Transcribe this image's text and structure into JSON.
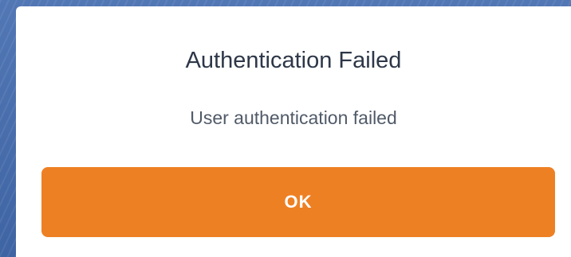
{
  "dialog": {
    "title": "Authentication Failed",
    "message": "User authentication failed",
    "ok_label": "OK"
  },
  "colors": {
    "accent": "#ee8024",
    "title_text": "#2d3748",
    "message_text": "#505a68",
    "backdrop": "#4a6fae"
  }
}
